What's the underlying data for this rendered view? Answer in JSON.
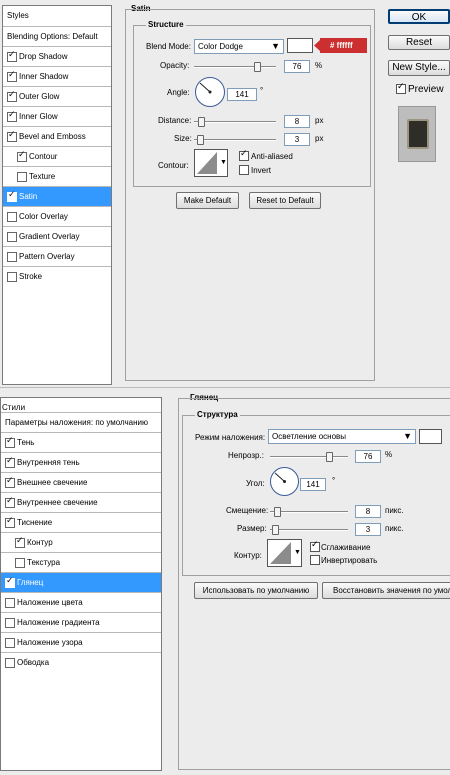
{
  "en": {
    "styles_header": "Styles",
    "items": [
      {
        "label": "Blending Options: Default",
        "kind": "head"
      },
      {
        "label": "Drop Shadow",
        "checked": true
      },
      {
        "label": "Inner Shadow",
        "checked": true
      },
      {
        "label": "Outer Glow",
        "checked": true
      },
      {
        "label": "Inner Glow",
        "checked": true
      },
      {
        "label": "Bevel and Emboss",
        "checked": true
      },
      {
        "label": "Contour",
        "checked": true,
        "indent": true
      },
      {
        "label": "Texture",
        "checked": false,
        "indent": true
      },
      {
        "label": "Satin",
        "checked": true,
        "selected": true
      },
      {
        "label": "Color Overlay",
        "checked": false
      },
      {
        "label": "Gradient Overlay",
        "checked": false
      },
      {
        "label": "Pattern Overlay",
        "checked": false
      },
      {
        "label": "Stroke",
        "checked": false
      }
    ],
    "section_title": "Satin",
    "group_title": "Structure",
    "blend_mode_label": "Blend Mode:",
    "blend_mode_value": "Color Dodge",
    "color_hex_callout": "# ffffff",
    "opacity_label": "Opacity:",
    "opacity_value": "76",
    "opacity_unit": "%",
    "angle_label": "Angle:",
    "angle_value": "141",
    "angle_unit": "°",
    "distance_label": "Distance:",
    "distance_value": "8",
    "distance_unit": "px",
    "size_label": "Size:",
    "size_value": "3",
    "size_unit": "px",
    "contour_label": "Contour:",
    "anti_aliased_label": "Anti-aliased",
    "anti_aliased_checked": true,
    "invert_label": "Invert",
    "invert_checked": false,
    "make_default": "Make Default",
    "reset_default": "Reset to Default",
    "ok": "OK",
    "reset": "Reset",
    "new_style": "New Style...",
    "preview_label": "Preview",
    "preview_checked": true
  },
  "ru": {
    "styles_header": "Стили",
    "items": [
      {
        "label": "Параметры наложения: по умолчанию",
        "kind": "head"
      },
      {
        "label": "Тень",
        "checked": true
      },
      {
        "label": "Внутренняя тень",
        "checked": true
      },
      {
        "label": "Внешнее свечение",
        "checked": true
      },
      {
        "label": "Внутреннее свечение",
        "checked": true
      },
      {
        "label": "Тиснение",
        "checked": true
      },
      {
        "label": "Контур",
        "checked": true,
        "indent": true
      },
      {
        "label": "Текстура",
        "checked": false,
        "indent": true
      },
      {
        "label": "Глянец",
        "checked": true,
        "selected": true
      },
      {
        "label": "Наложение цвета",
        "checked": false
      },
      {
        "label": "Наложение градиента",
        "checked": false
      },
      {
        "label": "Наложение узора",
        "checked": false
      },
      {
        "label": "Обводка",
        "checked": false
      }
    ],
    "section_title": "Глянец",
    "group_title": "Структура",
    "blend_mode_label": "Режим наложения:",
    "blend_mode_value": "Осветление основы",
    "opacity_label": "Непрозр.:",
    "opacity_value": "76",
    "opacity_unit": "%",
    "angle_label": "Угол:",
    "angle_value": "141",
    "angle_unit": "°",
    "distance_label": "Смещение:",
    "distance_value": "8",
    "distance_unit": "пикс.",
    "size_label": "Размер:",
    "size_value": "3",
    "size_unit": "пикс.",
    "contour_label": "Контур:",
    "anti_aliased_label": "Сглаживание",
    "anti_aliased_checked": true,
    "invert_label": "Инвертировать",
    "invert_checked": false,
    "make_default": "Использовать по умолчанию",
    "reset_default": "Восстановить значения по умолчанию"
  },
  "colors": {
    "selection": "#3399ff",
    "callout": "#cc2f2f",
    "swatch": "#ffffff"
  }
}
